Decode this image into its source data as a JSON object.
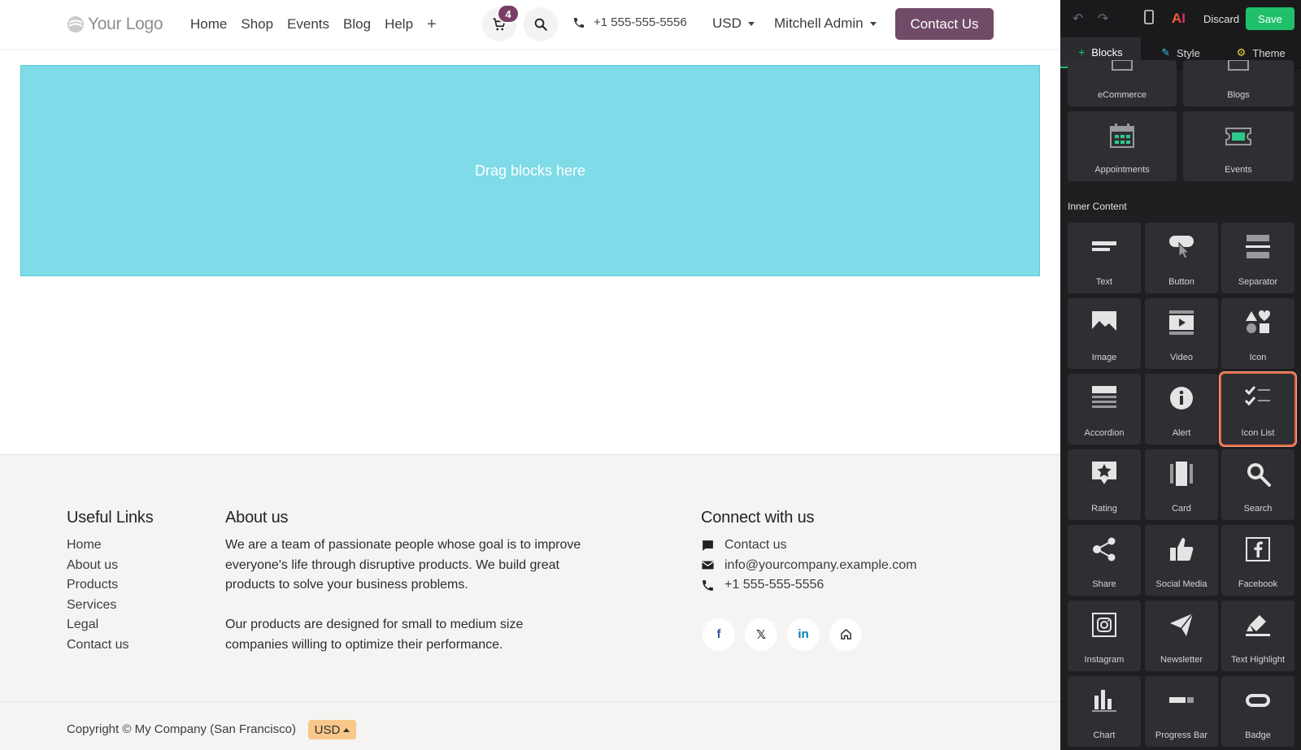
{
  "header": {
    "logo_text": "Your Logo",
    "nav": [
      "Home",
      "Shop",
      "Events",
      "Blog",
      "Help"
    ],
    "nav_add": "+",
    "cart_count": "4",
    "phone": "+1 555-555-5556",
    "currency": "USD",
    "user": "Mitchell Admin",
    "contact_button": "Contact Us"
  },
  "dropzone": {
    "text": "Drag blocks here"
  },
  "footer": {
    "links_title": "Useful Links",
    "links": [
      "Home",
      "About us",
      "Products",
      "Services",
      "Legal",
      "Contact us"
    ],
    "about_title": "About us",
    "about_p1": "We are a team of passionate people whose goal is to improve everyone's life through disruptive products. We build great products to solve your business problems.",
    "about_p2": "Our products are designed for small to medium size companies willing to optimize their performance.",
    "connect_title": "Connect with us",
    "connect_contact": "Contact us",
    "connect_email": "info@yourcompany.example.com",
    "connect_phone": "+1 555-555-5556",
    "social_icons": [
      "facebook-icon",
      "x-icon",
      "linkedin-icon",
      "home-icon"
    ]
  },
  "copyright": {
    "text": "Copyright © My Company (San Francisco)",
    "currency": "USD"
  },
  "editor": {
    "discard": "Discard",
    "save": "Save",
    "ai_label": "AI",
    "tabs": [
      "Blocks",
      "Style",
      "Theme"
    ],
    "top_tiles": [
      "eCommerce",
      "Blogs",
      "Appointments",
      "Events"
    ],
    "section_title": "Inner Content",
    "inner_tiles": [
      "Text",
      "Button",
      "Separator",
      "Image",
      "Video",
      "Icon",
      "Accordion",
      "Alert",
      "Icon List",
      "Rating",
      "Card",
      "Search",
      "Share",
      "Social Media",
      "Facebook",
      "Instagram",
      "Newsletter",
      "Text Highlight",
      "Chart",
      "Progress Bar",
      "Badge"
    ],
    "selected_tile": "Icon List"
  },
  "colors": {
    "brand": "#714b67",
    "dropzone": "#7edbe7",
    "save": "#20c06a",
    "selection": "#e06b45"
  }
}
